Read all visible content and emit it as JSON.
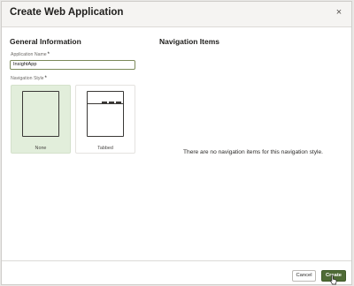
{
  "dialog": {
    "title": "Create Web Application",
    "close_glyph": "×"
  },
  "general": {
    "heading": "General Information",
    "app_name_label": "Application Name",
    "app_name_value": "InsightApp",
    "required_mark": "*",
    "nav_style_label": "Navigation Style",
    "styles": [
      {
        "label": "None",
        "selected": true
      },
      {
        "label": "Tabbed",
        "selected": false
      }
    ]
  },
  "navigation": {
    "heading": "Navigation Items",
    "empty_message": "There are no navigation items for this navigation style."
  },
  "footer": {
    "cancel_label": "Cancel",
    "create_label": "Create"
  },
  "colors": {
    "accent": "#4f6b36",
    "selected_tile": "#e2eedb",
    "input_border": "#7c8a5a"
  },
  "icons": [
    "close-icon",
    "pointer-cursor-icon"
  ]
}
